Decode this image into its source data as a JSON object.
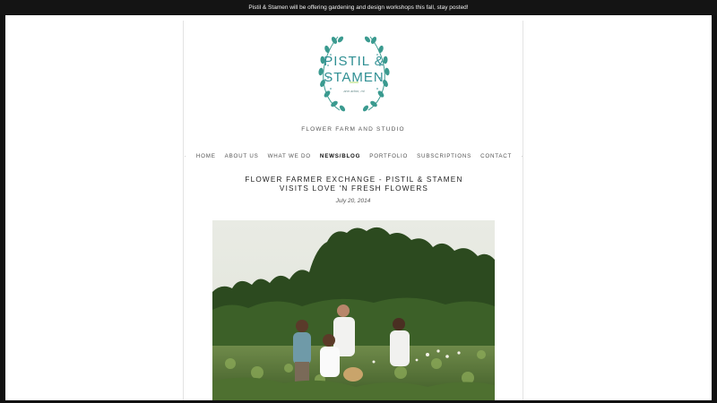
{
  "announcement": "Pistil & Stamen will be offering gardening and design workshops this fall, stay posted!",
  "logo": {
    "line1": "PISTIL &",
    "line2": "STAMEN",
    "subtitle": "ann arbor, mi"
  },
  "tagline": "FLOWER FARM AND STUDIO",
  "nav": {
    "items": [
      "HOME",
      "ABOUT US",
      "WHAT WE DO",
      "NEWS/BLOG",
      "PORTFOLIO",
      "SUBSCRIPTIONS",
      "CONTACT"
    ],
    "active": "NEWS/BLOG"
  },
  "post": {
    "title_line1": "FLOWER FARMER EXCHANGE - PISTIL & STAMEN",
    "title_line2": "VISITS LOVE 'N FRESH FLOWERS",
    "date": "July 20, 2014"
  },
  "colors": {
    "logo_teal": "#2f8f93",
    "leaf_green": "#3a9a8f",
    "accent_lime": "#9bd34a",
    "announce_bg": "#141414"
  }
}
